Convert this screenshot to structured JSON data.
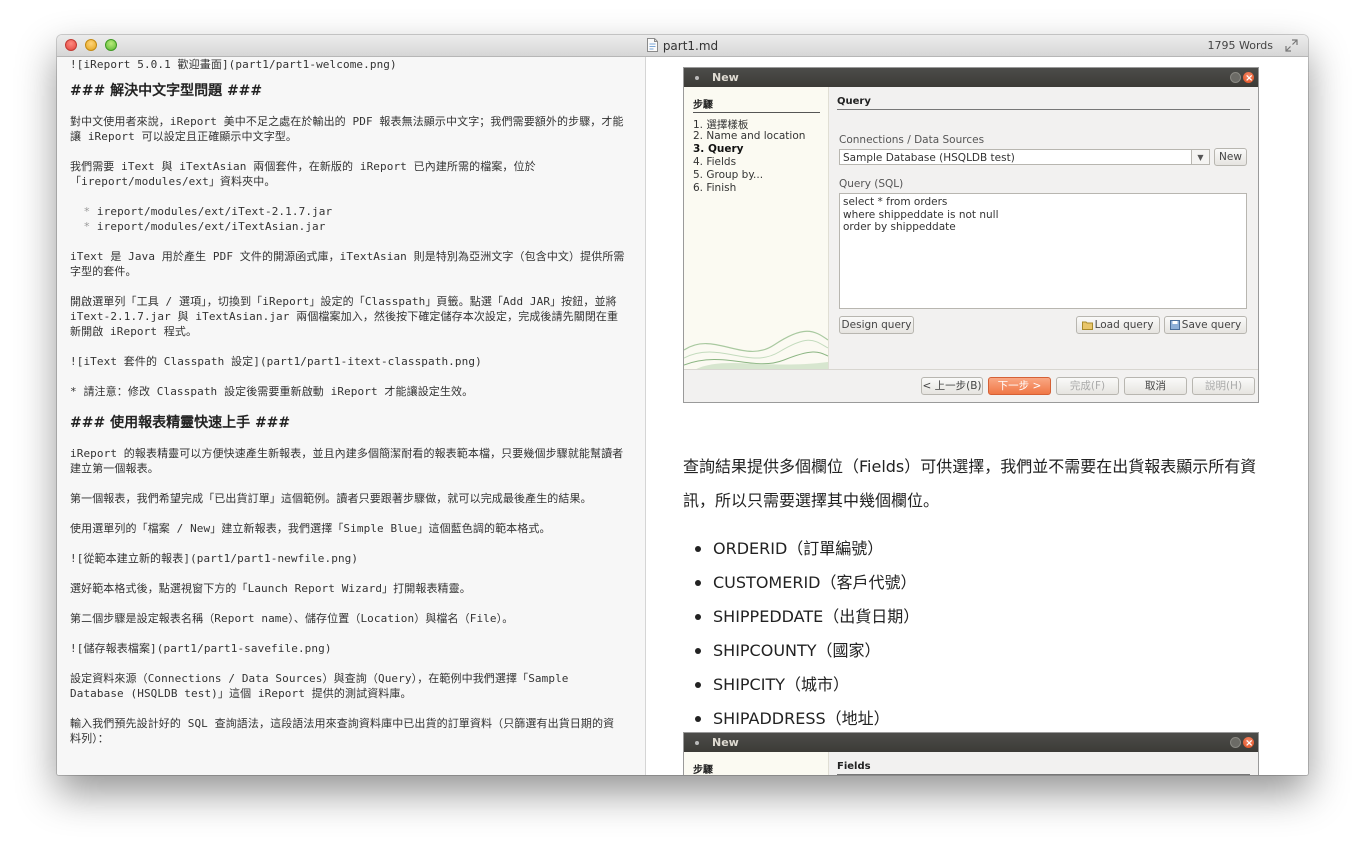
{
  "window": {
    "filename": "part1.md",
    "word_count": "1795 Words"
  },
  "editor": {
    "lines": [
      "![iReport 5.0.1 歡迎畫面](part1/part1-welcome.png)",
      "### 解決中文字型問題 ###",
      "對中文使用者來說，iReport 美中不足之處在於輸出的 PDF 報表無法顯示中文字；我們需要額外的步驟，才能讓 iReport 可以設定且正確顯示中文字型。",
      "我們需要 iText 與 iTextAsian 兩個套件，在新版的 iReport 已內建所需的檔案，位於「ireport/modules/ext」資料夾中。",
      "ireport/modules/ext/iText-2.1.7.jar",
      "ireport/modules/ext/iTextAsian.jar",
      "iText 是 Java 用於產生 PDF 文件的開源函式庫，iTextAsian 則是特別為亞洲文字（包含中文）提供所需字型的套件。",
      "開啟選單列「工具 / 選項」，切換到「iReport」設定的「Classpath」頁籤。點選「Add JAR」按鈕，並將 iText-2.1.7.jar 與 iTextAsian.jar 兩個檔案加入，然後按下確定儲存本次設定，完成後請先關閉在重新開啟 iReport 程式。",
      "![iText 套件的 Classpath 設定](part1/part1-itext-classpath.png)",
      "* 請注意：修改 Classpath 設定後需要重新啟動 iReport 才能讓設定生效。",
      "### 使用報表精靈快速上手 ###",
      "iReport 的報表精靈可以方便快速產生新報表，並且內建多個簡潔耐看的報表範本檔，只要幾個步驟就能幫讀者建立第一個報表。",
      "第一個報表，我們希望完成「已出貨訂單」這個範例。讀者只要跟著步驟做，就可以完成最後產生的結果。",
      "使用選單列的「檔案 / New」建立新報表，我們選擇「Simple Blue」這個藍色調的範本格式。",
      "![從範本建立新的報表](part1/part1-newfile.png)",
      "選好範本格式後，點選視窗下方的「Launch Report Wizard」打開報表精靈。",
      "第二個步驟是設定報表名稱（Report name）、儲存位置（Location）與檔名（File）。",
      "![儲存報表檔案](part1/part1-savefile.png)",
      "設定資料來源（Connections / Data Sources）與查詢（Query），在範例中我們選擇「Sample Database (HSQLDB test)」這個 iReport 提供的測試資料庫。",
      "輸入我們預先設計好的 SQL 查詢語法，這段語法用來查詢資料庫中已出貨的訂單資料（只篩選有出貨日期的資料列）："
    ],
    "bullet_char": "*"
  },
  "dialog1": {
    "title": "New",
    "steps_heading": "步驟",
    "steps": [
      "1.  選擇樣板",
      "2.  Name and location",
      "3.  Query",
      "4.  Fields",
      "5.  Group by...",
      "6.  Finish"
    ],
    "active_step": 2,
    "section_title": "Query",
    "connections_label": "Connections / Data Sources",
    "datasource_value": "Sample Database (HSQLDB test)",
    "new_button": "New",
    "query_label": "Query (SQL)",
    "sql_lines": [
      "select * from orders",
      "where shippeddate is not null",
      "order by shippeddate"
    ],
    "design_query": "Design query",
    "load_query": "Load query",
    "save_query": "Save query",
    "back": "< 上一步(B)",
    "next": "下一步 >",
    "finish": "完成(F)",
    "cancel": "取消",
    "help": "說明(H)"
  },
  "preview": {
    "paragraph": "查詢結果提供多個欄位（Fields）可供選擇，我們並不需要在出貨報表顯示所有資訊，所以只需要選擇其中幾個欄位。",
    "fields": [
      "ORDERID（訂單編號）",
      "CUSTOMERID（客戶代號）",
      "SHIPPEDDATE（出貨日期）",
      "SHIPCOUNTY（國家）",
      "SHIPCITY（城市）",
      "SHIPADDRESS（地址）"
    ]
  },
  "dialog2": {
    "title": "New",
    "steps_heading": "步驟",
    "section_title": "Fields"
  },
  "colors": {
    "primary_button": "#f07746",
    "dialog_titlebar": "#3c3b37",
    "editor_bg": "#f7f7f7"
  }
}
